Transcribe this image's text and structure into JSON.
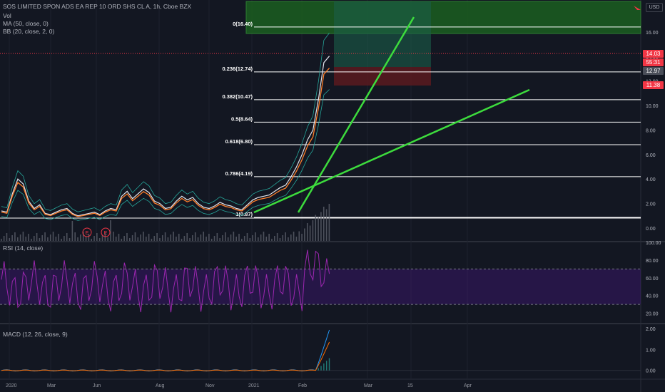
{
  "legend": {
    "title": "SOS LIMITED SPON ADS EA REP 10 ORD SHS CL A, 1h, Cboe BZX",
    "vol": "Vol",
    "ma": "MA (50, close, 0)",
    "bb": "BB (20, close, 2, 0)",
    "rsi": "RSI (14, close)",
    "macd": "MACD (12, 26, close, 9)"
  },
  "currency": "USD",
  "price_tags": [
    {
      "id": "last",
      "text": "14.03",
      "color": "#f23645"
    },
    {
      "id": "countdown",
      "text": "55:31",
      "color": "#f23645"
    },
    {
      "id": "ma",
      "text": "12.97",
      "color": "#4a4e59"
    },
    {
      "id": "stop",
      "text": "11.38",
      "color": "#f23645"
    }
  ],
  "colors": {
    "background": "#131722",
    "fib_line": "#ffffff",
    "trendline": "#3ddc3d",
    "up": "#26a69a",
    "down": "#ef5350",
    "ma_line": "#ff7f2a",
    "rsi_line": "#9c27b0",
    "macd_line": "#2196f3",
    "signal_line": "#ff6d00",
    "target_zone": "#1b5e20",
    "stop_zone": "#5a1a1e"
  },
  "events": [
    "E",
    "E"
  ],
  "chart_data": [
    {
      "type": "line",
      "name": "price",
      "x_axis_labels": [
        "2020",
        "Mar",
        "Jun",
        "Aug",
        "Nov",
        "2021",
        "Feb",
        "Mar",
        "15",
        "Apr"
      ],
      "y_axis_labels": [
        "0.00",
        "2.00",
        "4.00",
        "6.00",
        "8.00",
        "10.00",
        "12.00",
        "14.00",
        "16.00"
      ],
      "ylim": [
        -0.5,
        18
      ],
      "fib_levels": [
        {
          "label": "0(16.40)",
          "value": 16.4
        },
        {
          "label": "0.236(12.74)",
          "value": 12.74
        },
        {
          "label": "0.382(10.47)",
          "value": 10.47
        },
        {
          "label": "0.5(8.64)",
          "value": 8.64
        },
        {
          "label": "0.618(6.80)",
          "value": 6.8
        },
        {
          "label": "0.786(4.19)",
          "value": 4.19
        },
        {
          "label": "1(0.87)",
          "value": 0.87
        }
      ],
      "approx_close_path": [
        [
          0,
          1.4
        ],
        [
          2,
          1.3
        ],
        [
          4,
          2.8
        ],
        [
          6,
          4.0
        ],
        [
          8,
          3.6
        ],
        [
          10,
          2.2
        ],
        [
          12,
          1.6
        ],
        [
          14,
          1.9
        ],
        [
          16,
          1.2
        ],
        [
          18,
          1.1
        ],
        [
          20,
          1.3
        ],
        [
          22,
          1.5
        ],
        [
          24,
          1.6
        ],
        [
          26,
          1.2
        ],
        [
          28,
          1.0
        ],
        [
          30,
          1.1
        ],
        [
          32,
          1.2
        ],
        [
          34,
          1.3
        ],
        [
          36,
          1.1
        ],
        [
          38,
          1.4
        ],
        [
          40,
          1.6
        ],
        [
          42,
          1.5
        ],
        [
          44,
          2.6
        ],
        [
          46,
          3.0
        ],
        [
          48,
          2.4
        ],
        [
          50,
          2.8
        ],
        [
          52,
          3.2
        ],
        [
          54,
          2.9
        ],
        [
          56,
          2.2
        ],
        [
          58,
          2.0
        ],
        [
          60,
          1.6
        ],
        [
          62,
          1.7
        ],
        [
          64,
          2.2
        ],
        [
          66,
          2.6
        ],
        [
          68,
          2.3
        ],
        [
          70,
          2.5
        ],
        [
          72,
          2.0
        ],
        [
          74,
          1.7
        ],
        [
          76,
          1.6
        ],
        [
          78,
          1.8
        ],
        [
          80,
          2.1
        ],
        [
          82,
          1.9
        ],
        [
          84,
          1.8
        ],
        [
          86,
          1.6
        ],
        [
          88,
          1.5
        ],
        [
          90,
          1.9
        ],
        [
          92,
          2.3
        ],
        [
          94,
          2.5
        ],
        [
          96,
          2.6
        ],
        [
          98,
          2.7
        ],
        [
          100,
          3.0
        ],
        [
          102,
          3.3
        ],
        [
          104,
          3.5
        ],
        [
          106,
          4.2
        ],
        [
          108,
          5.0
        ],
        [
          110,
          6.0
        ],
        [
          112,
          7.2
        ],
        [
          114,
          8.0
        ],
        [
          116,
          10.5
        ],
        [
          118,
          13.5
        ],
        [
          120,
          14.03
        ]
      ],
      "trendlines": [
        {
          "from": [
            0,
            0.9
          ],
          "to": [
            100,
            16.9
          ]
        },
        {
          "from": [
            0,
            0.9
          ],
          "to": [
            100,
            11.0
          ]
        }
      ]
    },
    {
      "type": "line",
      "name": "RSI",
      "y_axis_labels": [
        "20.00",
        "40.00",
        "60.00",
        "80.00",
        "100.00"
      ],
      "ylim": [
        10,
        100
      ],
      "bands": [
        30,
        70
      ]
    },
    {
      "type": "line",
      "name": "MACD",
      "y_axis_labels": [
        "0.00",
        "1.00",
        "2.00"
      ],
      "ylim": [
        -0.35,
        2.2
      ]
    }
  ]
}
